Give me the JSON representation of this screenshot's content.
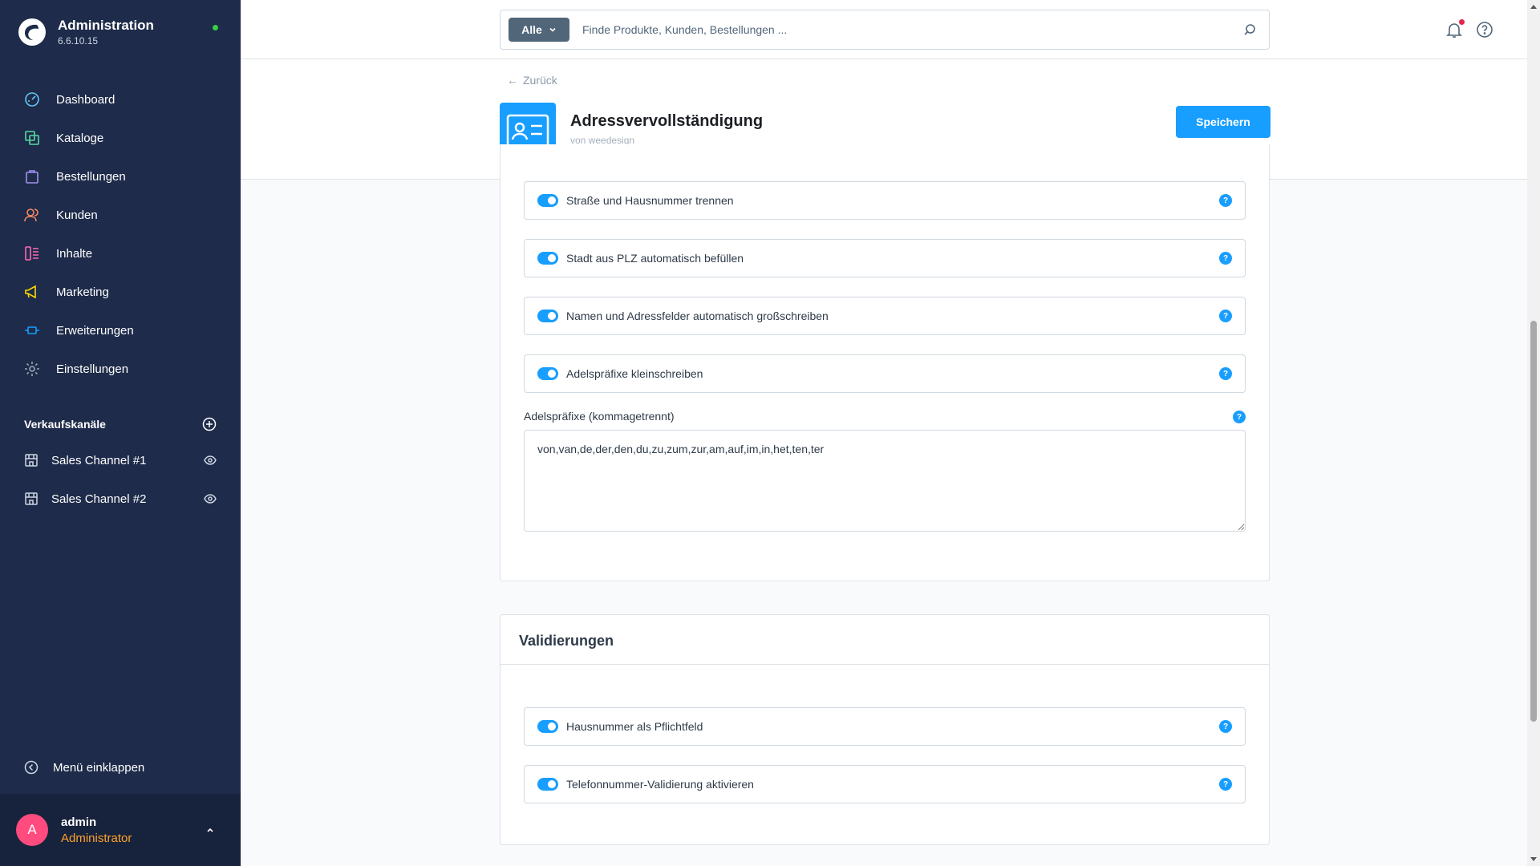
{
  "brand": {
    "title": "Administration",
    "version": "6.6.10.15"
  },
  "sidebar": {
    "items": [
      {
        "label": "Dashboard",
        "icon": "dashboard-icon",
        "color": "#62c6f7"
      },
      {
        "label": "Kataloge",
        "icon": "catalog-icon",
        "color": "#57d9a3"
      },
      {
        "label": "Bestellungen",
        "icon": "orders-icon",
        "color": "#a092f0"
      },
      {
        "label": "Kunden",
        "icon": "customers-icon",
        "color": "#f88962"
      },
      {
        "label": "Inhalte",
        "icon": "content-icon",
        "color": "#ff68b4"
      },
      {
        "label": "Marketing",
        "icon": "marketing-icon",
        "color": "#ffd700"
      },
      {
        "label": "Erweiterungen",
        "icon": "extensions-icon",
        "color": "#189eff"
      },
      {
        "label": "Einstellungen",
        "icon": "settings-icon",
        "color": "#9aa8b5"
      }
    ],
    "sales_channels_title": "Verkaufskanäle",
    "sales_channels": [
      {
        "label": "Sales Channel #1"
      },
      {
        "label": "Sales Channel #2"
      }
    ],
    "collapse_label": "Menü einklappen"
  },
  "user": {
    "initial": "A",
    "name": "admin",
    "role": "Administrator"
  },
  "search": {
    "type_label": "Alle",
    "placeholder": "Finde Produkte, Kunden, Bestellungen ..."
  },
  "header": {
    "back_label": "Zurück",
    "plugin_title": "Adressvervollständigung",
    "plugin_author": "von weedesign",
    "save_label": "Speichern"
  },
  "settings_card": {
    "toggles": [
      {
        "label": "Straße und Hausnummer trennen",
        "enabled": true
      },
      {
        "label": "Stadt aus PLZ automatisch befüllen",
        "enabled": true
      },
      {
        "label": "Namen und Adressfelder automatisch großschreiben",
        "enabled": true
      },
      {
        "label": "Adelspräfixe kleinschreiben",
        "enabled": true
      }
    ],
    "prefix_field": {
      "label": "Adelspräfixe (kommagetrennt)",
      "value": "von,van,de,der,den,du,zu,zum,zur,am,auf,im,in,het,ten,ter"
    }
  },
  "validation_card": {
    "title": "Validierungen",
    "toggles": [
      {
        "label": "Hausnummer als Pflichtfeld",
        "enabled": true
      },
      {
        "label": "Telefonnummer-Validierung aktivieren",
        "enabled": true
      }
    ]
  },
  "colors": {
    "sidebar_bg": "#1e2b4a",
    "accent": "#189eff",
    "role_color": "#ffa229",
    "avatar_bg": "#ff4b7e"
  }
}
